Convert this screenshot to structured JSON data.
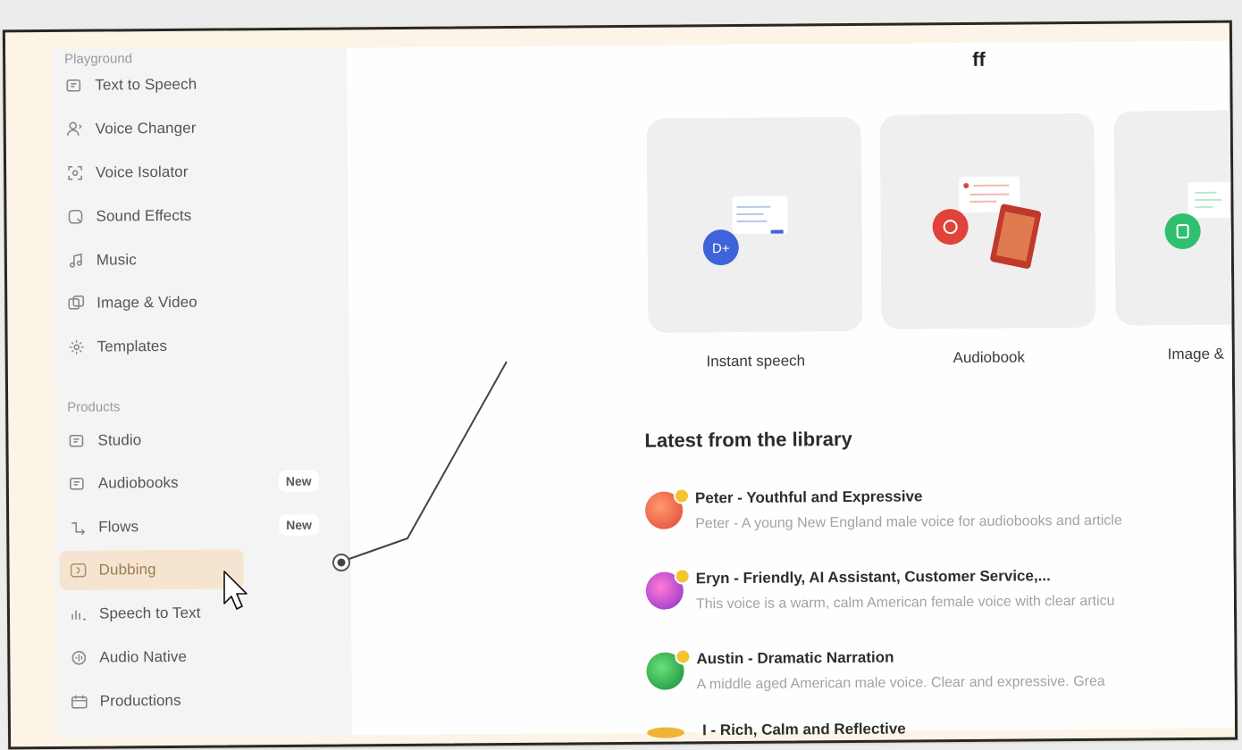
{
  "sidebar": {
    "section_top": "Playground",
    "items": [
      {
        "label": "Text to Speech",
        "icon": "text-to-speech-icon"
      },
      {
        "label": "Voice Changer",
        "icon": "voice-changer-icon"
      },
      {
        "label": "Voice Isolator",
        "icon": "voice-isolator-icon"
      },
      {
        "label": "Sound Effects",
        "icon": "sound-effects-icon"
      },
      {
        "label": "Music",
        "icon": "music-icon"
      },
      {
        "label": "Image & Video",
        "icon": "image-video-icon"
      },
      {
        "label": "Templates",
        "icon": "templates-icon"
      }
    ],
    "section_products": "Products",
    "products": [
      {
        "label": "Studio",
        "icon": "studio-icon",
        "badge": ""
      },
      {
        "label": "Audiobooks",
        "icon": "audiobooks-icon",
        "badge": "New"
      },
      {
        "label": "Flows",
        "icon": "flows-icon",
        "badge": "New"
      },
      {
        "label": "Dubbing",
        "icon": "dubbing-icon",
        "badge": "",
        "active": true
      },
      {
        "label": "Speech to Text",
        "icon": "speech-to-text-icon",
        "badge": ""
      },
      {
        "label": "Audio Native",
        "icon": "audio-native-icon",
        "badge": ""
      },
      {
        "label": "Productions",
        "icon": "productions-icon",
        "badge": ""
      }
    ]
  },
  "header": {
    "glyph": "ff"
  },
  "cards": [
    {
      "title": "Instant speech",
      "accent": "#3f63d8"
    },
    {
      "title": "Audiobook",
      "accent": "#e0433a"
    },
    {
      "title": "Image &",
      "accent": "#2fbf71"
    }
  ],
  "library": {
    "title": "Latest from the library",
    "voices": [
      {
        "name": "Peter - Youthful and Expressive",
        "desc": "Peter - A young New England male voice for audiobooks and article",
        "color": "#f06a4a"
      },
      {
        "name": "Eryn - Friendly, AI Assistant, Customer Service,...",
        "desc": "This voice is a warm, calm American female voice with clear articu",
        "color": "#c34bd6"
      },
      {
        "name": "Austin - Dramatic Narration",
        "desc": "A middle aged American male voice. Clear and expressive. Grea",
        "color": "#2bb04a"
      },
      {
        "name": "I - Rich, Calm and Reflective",
        "desc": "",
        "color": "#f0b437"
      }
    ]
  },
  "colors": {
    "frame_bg": "#fcf4e6",
    "active_bg": "#f5e5d0",
    "sidebar_bg": "#f4f4f4"
  }
}
